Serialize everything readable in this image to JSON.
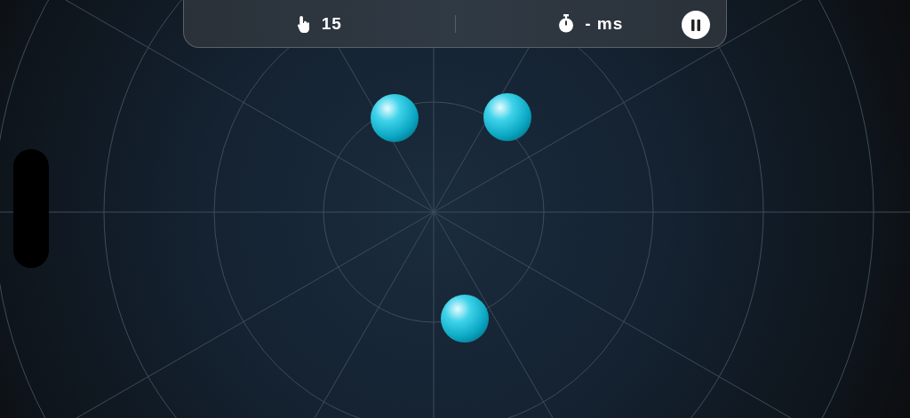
{
  "hud": {
    "taps": "15",
    "time": "- ms"
  }
}
